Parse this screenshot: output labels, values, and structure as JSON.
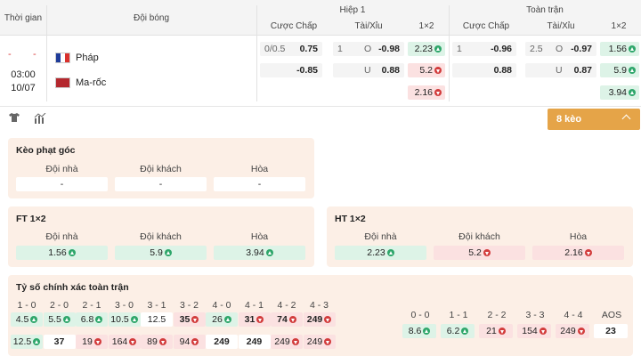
{
  "header": {
    "time": "Thời gian",
    "team": "Đội bóng",
    "half1": "Hiệp 1",
    "fulltime": "Toàn trận",
    "handicap": "Cược Chấp",
    "overunder": "Tài/Xỉu",
    "onextwo": "1×2"
  },
  "match": {
    "dash1": "-",
    "dash2": "-",
    "time": "03:00",
    "date": "10/07",
    "home": "Pháp",
    "away": "Ma-rốc",
    "h1": {
      "hcp_line": "0/0.5",
      "hcp_home": "0.75",
      "hcp_away": "-0.85",
      "ou_line": "1",
      "ou_o": "O",
      "ou_u": "U",
      "ou_over": "-0.98",
      "ou_under": "0.88",
      "x1": "2.23",
      "x2": "5.2",
      "xd": "2.16"
    },
    "ft": {
      "hcp_line": "1",
      "hcp_home": "-0.96",
      "hcp_away": "0.88",
      "ou_line": "2.5",
      "ou_o": "O",
      "ou_u": "U",
      "ou_over": "-0.97",
      "ou_under": "0.87",
      "x1": "1.56",
      "x2": "5.9",
      "xd": "3.94"
    }
  },
  "tools": {
    "keo": "8 kèo"
  },
  "corner": {
    "title": "Kèo phạt góc",
    "labels": [
      "Đội nhà",
      "Đội khách",
      "Hòa"
    ],
    "values": [
      "-",
      "-",
      "-"
    ]
  },
  "ft12": {
    "title": "FT 1×2",
    "labels": [
      "Đội nhà",
      "Đội khách",
      "Hòa"
    ],
    "values": [
      "1.56",
      "5.9",
      "3.94"
    ]
  },
  "ht12": {
    "title": "HT 1×2",
    "labels": [
      "Đội nhà",
      "Đội khách",
      "Hòa"
    ],
    "values": [
      "2.23",
      "5.2",
      "2.16"
    ]
  },
  "correct": {
    "title": "Tỷ số chính xác toàn trận",
    "home_scores": [
      "1 - 0",
      "2 - 0",
      "2 - 1",
      "3 - 0",
      "3 - 1",
      "3 - 2",
      "4 - 0",
      "4 - 1",
      "4 - 2",
      "4 - 3"
    ],
    "home_odds": [
      "4.5",
      "5.5",
      "6.8",
      "10.5",
      "12.5",
      "35",
      "26",
      "31",
      "74",
      "249"
    ],
    "away_odds": [
      "12.5",
      "37",
      "19",
      "164",
      "89",
      "94",
      "249",
      "249",
      "249",
      "249"
    ],
    "draw_scores": [
      "0 - 0",
      "1 - 1",
      "2 - 2",
      "3 - 3",
      "4 - 4",
      "AOS"
    ],
    "draw_odds": [
      "8.6",
      "6.2",
      "21",
      "154",
      "249",
      "23"
    ]
  }
}
